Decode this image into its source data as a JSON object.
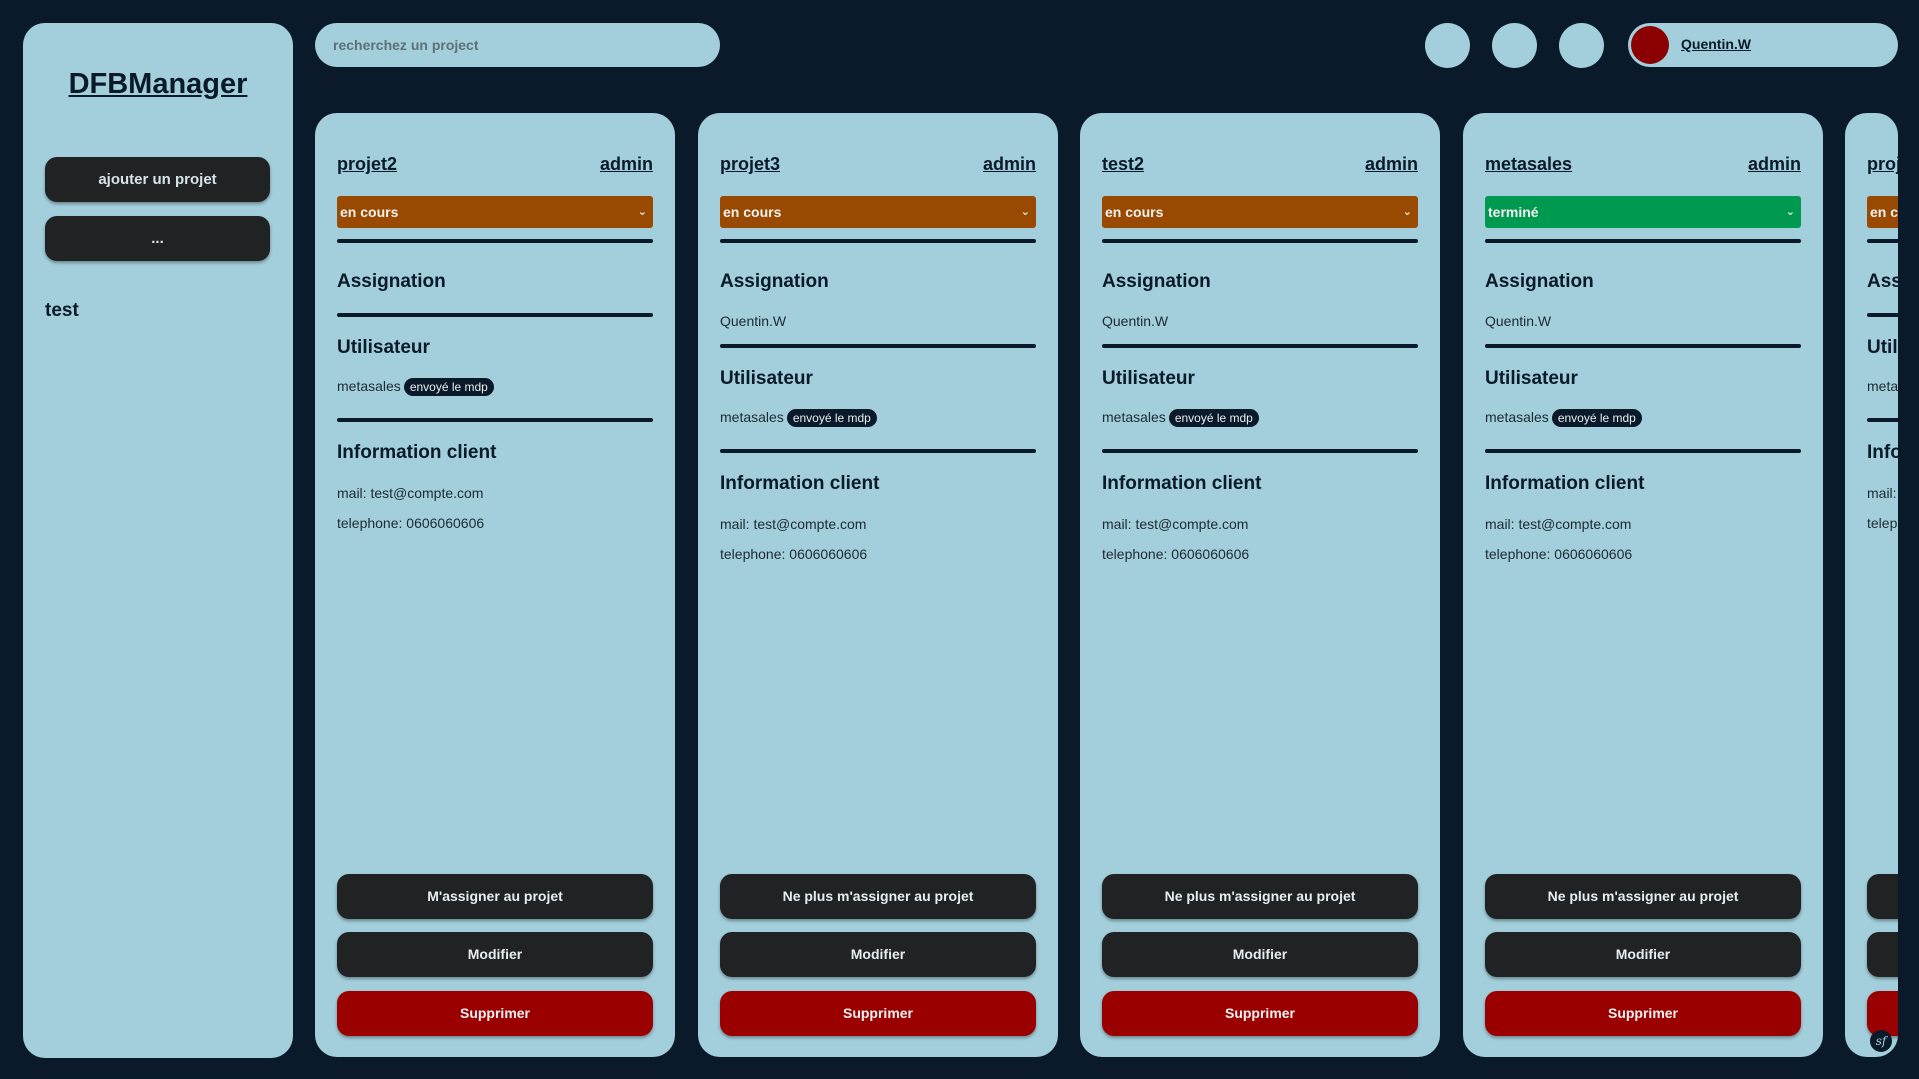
{
  "sidebar": {
    "brand": "DFBManager",
    "add_project_label": "ajouter un projet",
    "more_label": "...",
    "item_label": "test"
  },
  "header": {
    "search_placeholder": "recherchez un project",
    "user_name": "Quentin.W"
  },
  "colors": {
    "en_cours": "#9a4a00",
    "termine": "#009950",
    "danger": "#9b0000"
  },
  "labels": {
    "assignation": "Assignation",
    "utilisateur": "Utilisateur",
    "information_client": "Information client",
    "badge": "envoyé le mdp",
    "modifier": "Modifier",
    "supprimer": "Supprimer"
  },
  "projects": [
    {
      "name": "projet2",
      "role": "admin",
      "status": "en cours",
      "status_color": "#9a4a00",
      "assignee": "",
      "user": "metasales",
      "mail": "mail: test@compte.com",
      "telephone": "telephone: 0606060606",
      "assign_button": "M'assigner au projet"
    },
    {
      "name": "projet3",
      "role": "admin",
      "status": "en cours",
      "status_color": "#9a4a00",
      "assignee": "Quentin.W",
      "user": "metasales",
      "mail": "mail: test@compte.com",
      "telephone": "telephone: 0606060606",
      "assign_button": "Ne plus m'assigner au projet"
    },
    {
      "name": "test2",
      "role": "admin",
      "status": "en cours",
      "status_color": "#9a4a00",
      "assignee": "Quentin.W",
      "user": "metasales",
      "mail": "mail: test@compte.com",
      "telephone": "telephone: 0606060606",
      "assign_button": "Ne plus m'assigner au projet"
    },
    {
      "name": "metasales",
      "role": "admin",
      "status": "terminé",
      "status_color": "#009950",
      "assignee": "Quentin.W",
      "user": "metasales",
      "mail": "mail: test@compte.com",
      "telephone": "telephone: 0606060606",
      "assign_button": "Ne plus m'assigner au projet"
    },
    {
      "name": "proj",
      "role": "",
      "status": "en c",
      "status_color": "#9a4a00",
      "assignee": "",
      "user": "meta",
      "mail": "mail:",
      "telephone": "telep",
      "assign_button": "",
      "partial": true,
      "section_assignation": "Ass",
      "section_utilisateur": "Util",
      "section_information": "Info"
    }
  ]
}
